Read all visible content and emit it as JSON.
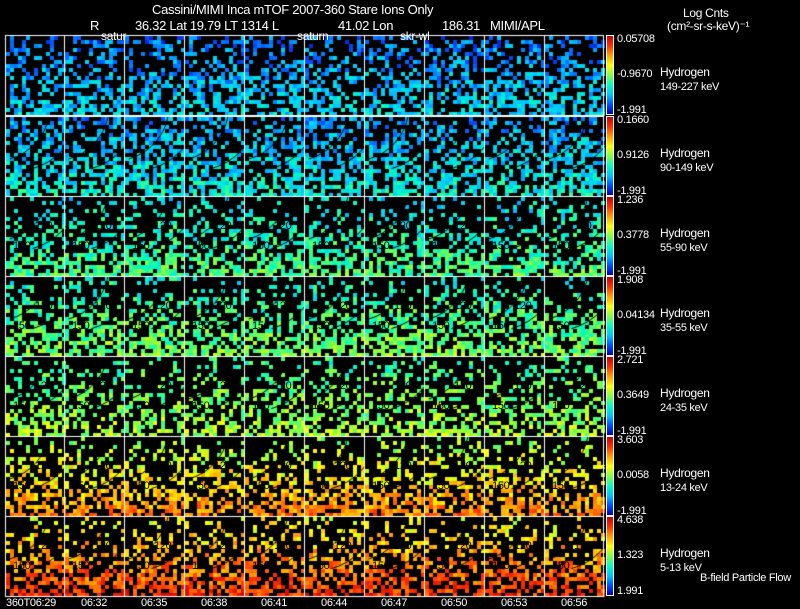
{
  "header": {
    "title": "Cassini/MIMI Inca mTOF  2007-360   Stare   Ions Only",
    "r_label": "R",
    "position": "36.32 Lat 19.79 LT 1314 L",
    "lon": "41.02 Lon",
    "lon_value": "186.31",
    "source": "MIMI/APL",
    "markers": [
      "satur",
      "saturn",
      "skr-wl"
    ]
  },
  "units": {
    "line1": "Log Cnts",
    "line2": "(cm²-sr-s-keV)⁻¹"
  },
  "footer_label": "B-field Particle Flow",
  "chart_data": {
    "type": "heatmap",
    "x_tick_labels": [
      "360T06:29",
      "06:32",
      "06:35",
      "06:38",
      "06:41",
      "06:44",
      "06:47",
      "06:50",
      "06:53",
      "06:56"
    ],
    "contour_labels": [
      "120",
      "150"
    ],
    "rows": [
      {
        "species": "Hydrogen",
        "energy": "149-227 keV",
        "cb_max": "0.05708",
        "cb_mid": "-0.9670",
        "cb_min": "-1.991"
      },
      {
        "species": "Hydrogen",
        "energy": "90-149 keV",
        "cb_max": "0.1660",
        "cb_mid": "0.9126",
        "cb_min": "-1.991"
      },
      {
        "species": "Hydrogen",
        "energy": "55-90 keV",
        "cb_max": "1.236",
        "cb_mid": "0.3778",
        "cb_min": "-1.991"
      },
      {
        "species": "Hydrogen",
        "energy": "35-55 keV",
        "cb_max": "1.908",
        "cb_mid": "0.04134",
        "cb_min": "-1.991"
      },
      {
        "species": "Hydrogen",
        "energy": "24-35 keV",
        "cb_max": "2.721",
        "cb_mid": "0.3649",
        "cb_min": "-1.991"
      },
      {
        "species": "Hydrogen",
        "energy": "13-24 keV",
        "cb_max": "3.603",
        "cb_mid": "0.0058",
        "cb_min": "-1.991"
      },
      {
        "species": "Hydrogen",
        "energy": "5-13 keV",
        "cb_max": "4.638",
        "cb_mid": "1.323",
        "cb_min": "1.991"
      }
    ]
  }
}
